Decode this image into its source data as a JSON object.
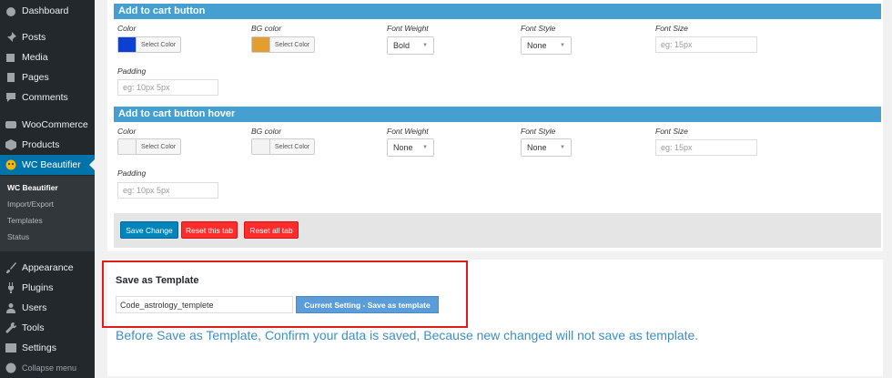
{
  "sidebar": {
    "items": [
      {
        "label": "Dashboard",
        "icon": "dashboard-icon"
      },
      {
        "label": "Posts",
        "icon": "pushpin-icon"
      },
      {
        "label": "Media",
        "icon": "media-icon"
      },
      {
        "label": "Pages",
        "icon": "pages-icon"
      },
      {
        "label": "Comments",
        "icon": "comment-icon"
      },
      {
        "label": "WooCommerce",
        "icon": "woocommerce-icon"
      },
      {
        "label": "Products",
        "icon": "products-icon"
      },
      {
        "label": "WC Beautifier",
        "icon": "beautifier-icon"
      },
      {
        "label": "Appearance",
        "icon": "brush-icon"
      },
      {
        "label": "Plugins",
        "icon": "plugin-icon"
      },
      {
        "label": "Users",
        "icon": "users-icon"
      },
      {
        "label": "Tools",
        "icon": "wrench-icon"
      },
      {
        "label": "Settings",
        "icon": "settings-icon"
      },
      {
        "label": "Collapse menu",
        "icon": "collapse-icon"
      }
    ],
    "submenu": [
      "WC Beautifier",
      "Import/Export",
      "Templates",
      "Status"
    ]
  },
  "sections": [
    {
      "title": "Add to cart button",
      "labels": {
        "color": "Color",
        "bg": "BG color",
        "weight": "Font Weight",
        "style": "Font Style",
        "size": "Font Size",
        "padding": "Padding"
      },
      "color_btn": "Select Color",
      "bg_btn": "Select Color",
      "color_value": "#0d3fd1",
      "bg_value": "#e39e2e",
      "weight": "Bold",
      "style": "None",
      "size_placeholder": "eg: 15px",
      "padding_placeholder": "eg: 10px 5px"
    },
    {
      "title": "Add to cart button hover",
      "labels": {
        "color": "Color",
        "bg": "BG color",
        "weight": "Font Weight",
        "style": "Font Style",
        "size": "Font Size",
        "padding": "Padding"
      },
      "color_btn": "Select Color",
      "bg_btn": "Select Color",
      "color_value": "#f3f3f3",
      "bg_value": "#f3f3f3",
      "weight": "None",
      "style": "None",
      "size_placeholder": "eg: 15px",
      "padding_placeholder": "eg: 10px 5px"
    }
  ],
  "actions": {
    "save": "Save Change",
    "reset_tab": "Reset this tab",
    "reset_all": "Reset all tab"
  },
  "template": {
    "title": "Save as Template",
    "input_value": "Code_astrology_templete",
    "button": "Current Setting - Save as template",
    "notice": "Before Save as Template, Confirm your data is saved, Because new changed will not save as template."
  },
  "colors": {
    "accent": "#0073aa",
    "header": "#45a0d1",
    "danger": "#ff2c2c",
    "highlight": "#e01b1b"
  }
}
